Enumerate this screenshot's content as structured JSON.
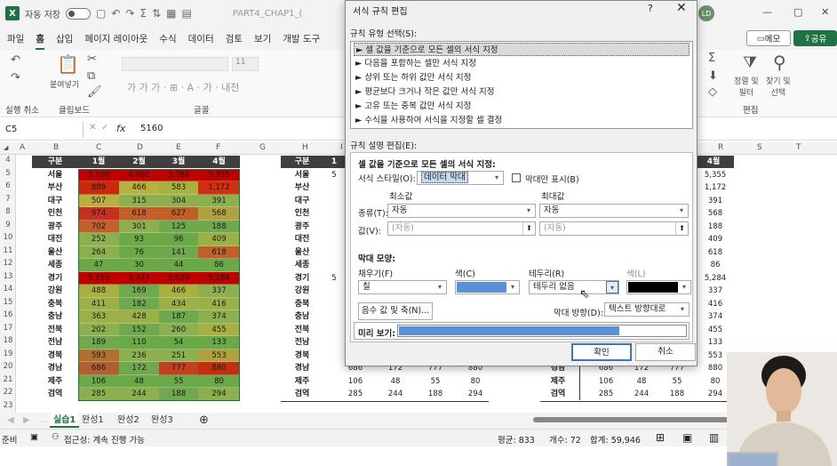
{
  "titlebar": {
    "app_icon": "X",
    "autosave": "자동 저장",
    "filename": "PART4_CHAP1_(",
    "avatar": "LD",
    "icons": [
      "save-icon",
      "undo-icon",
      "redo-icon"
    ]
  },
  "tabs": [
    "파일",
    "홈",
    "삽입",
    "페이지 레이아웃",
    "수식",
    "데이터",
    "검토",
    "보기",
    "개발 도구"
  ],
  "active_tab": "홈",
  "buttons": {
    "memo": "메모",
    "share": "공유"
  },
  "ribbon": {
    "undo_label": "실행 취소",
    "clipboard_label": "클립보드",
    "paste_label": "붙여넣기",
    "font_label": "글꼴",
    "font_size": "11",
    "edit_label": "편집",
    "sort_filter": "정렬 및\n필터",
    "find_select": "찾기 및\n선택"
  },
  "formula_bar": {
    "name_box": "C5",
    "fx": "fx",
    "value": "5160"
  },
  "columns": [
    "A",
    "B",
    "C",
    "D",
    "E",
    "F",
    "G",
    "H",
    "I",
    "R",
    "S",
    "T"
  ],
  "rows": [
    "4",
    "5",
    "6",
    "7",
    "8",
    "9",
    "10",
    "11",
    "12",
    "13",
    "14",
    "15",
    "16",
    "17",
    "18",
    "19",
    "20",
    "21",
    "22",
    "23"
  ],
  "table_left": {
    "headers": [
      "구분",
      "1월",
      "2월",
      "3월",
      "4월"
    ],
    "rows": [
      {
        "region": "서울",
        "v": [
          "5,160",
          "4,080",
          "3,784",
          "5,355"
        ]
      },
      {
        "region": "부산",
        "v": [
          "889",
          "466",
          "583",
          "1,172"
        ]
      },
      {
        "region": "대구",
        "v": [
          "507",
          "315",
          "304",
          "391"
        ]
      },
      {
        "region": "인천",
        "v": [
          "974",
          "618",
          "627",
          "568"
        ]
      },
      {
        "region": "광주",
        "v": [
          "702",
          "301",
          "125",
          "188"
        ]
      },
      {
        "region": "대전",
        "v": [
          "252",
          "93",
          "96",
          "409"
        ]
      },
      {
        "region": "울산",
        "v": [
          "264",
          "76",
          "141",
          "618"
        ]
      },
      {
        "region": "세종",
        "v": [
          "47",
          "30",
          "44",
          "86"
        ]
      },
      {
        "region": "경기",
        "v": [
          "5,153",
          "3,747",
          "5,029",
          "5,284"
        ]
      },
      {
        "region": "강원",
        "v": [
          "488",
          "169",
          "466",
          "337"
        ]
      },
      {
        "region": "충북",
        "v": [
          "411",
          "182",
          "434",
          "416"
        ]
      },
      {
        "region": "충남",
        "v": [
          "363",
          "428",
          "187",
          "374"
        ]
      },
      {
        "region": "전북",
        "v": [
          "202",
          "152",
          "260",
          "455"
        ]
      },
      {
        "region": "전남",
        "v": [
          "189",
          "110",
          "54",
          "133"
        ]
      },
      {
        "region": "경북",
        "v": [
          "593",
          "236",
          "251",
          "553"
        ]
      },
      {
        "region": "경남",
        "v": [
          "686",
          "172",
          "777",
          "880"
        ]
      },
      {
        "region": "제주",
        "v": [
          "106",
          "48",
          "55",
          "80"
        ]
      },
      {
        "region": "검역",
        "v": [
          "285",
          "244",
          "188",
          "294"
        ]
      }
    ],
    "colors": [
      [
        "#c00000",
        "#c00000",
        "#c00000",
        "#c00000"
      ],
      [
        "#c82a0a",
        "#b8b040",
        "#a8b040",
        "#d03010"
      ],
      [
        "#b8b040",
        "#8cb050",
        "#8cb050",
        "#8cb050"
      ],
      [
        "#c63020",
        "#c06028",
        "#c06028",
        "#b0a040"
      ],
      [
        "#c0602a",
        "#8cb050",
        "#70a850",
        "#70a850"
      ],
      [
        "#8cb050",
        "#6aa848",
        "#6aa848",
        "#9cb048"
      ],
      [
        "#8cb050",
        "#6aa848",
        "#70a850",
        "#c06028"
      ],
      [
        "#6aa848",
        "#6aa848",
        "#6aa848",
        "#6aa848"
      ],
      [
        "#c00000",
        "#c00000",
        "#c00000",
        "#c00000"
      ],
      [
        "#a8b040",
        "#70a850",
        "#a8b040",
        "#8cb050"
      ],
      [
        "#9cb048",
        "#70a850",
        "#9cb048",
        "#9cb048"
      ],
      [
        "#9cb048",
        "#9cb048",
        "#70a850",
        "#8cb050"
      ],
      [
        "#8cb050",
        "#70a850",
        "#8cb050",
        "#a8b040"
      ],
      [
        "#70a850",
        "#6aa848",
        "#6aa848",
        "#6aa848"
      ],
      [
        "#b07030",
        "#8cb050",
        "#8cb050",
        "#b0a040"
      ],
      [
        "#b06030",
        "#70a850",
        "#c04020",
        "#c03010"
      ],
      [
        "#6aa848",
        "#6aa848",
        "#6aa848",
        "#6aa848"
      ],
      [
        "#8cb050",
        "#8cb050",
        "#70a850",
        "#8cb050"
      ]
    ]
  },
  "table_right": {
    "h_header": "구분",
    "h_header_1": "1",
    "h_col4_header": "4월",
    "h_col4": [
      "5,355",
      "1,172",
      "391",
      "568",
      "188",
      "409",
      "618",
      "86",
      "5,284",
      "337",
      "416",
      "374",
      "455",
      "133",
      "553",
      "880",
      "80",
      "294"
    ],
    "h_regions": [
      "서울",
      "부산",
      "대구",
      "인천",
      "광주",
      "대전",
      "울산",
      "세종",
      "경기",
      "강원",
      "충북",
      "충남",
      "전북",
      "전남",
      "경북",
      "경남",
      "제주",
      "검역"
    ],
    "h_first": [
      "5",
      "",
      "",
      "",
      "",
      "",
      "",
      "",
      "5",
      "",
      "",
      "",
      "",
      "",
      "",
      "",
      "",
      ""
    ],
    "bottom_rows": [
      {
        "region": "경남",
        "v": [
          "686",
          "172",
          "777",
          "880"
        ]
      },
      {
        "region": "제주",
        "v": [
          "106",
          "48",
          "55",
          "80"
        ]
      },
      {
        "region": "검역",
        "v": [
          "285",
          "244",
          "188",
          "294"
        ]
      }
    ]
  },
  "dialog": {
    "title": "서식 규칙 편집",
    "help": "?",
    "close": "✕",
    "rule_type_label": "규칙 유형 선택(S):",
    "rule_types": [
      "► 셀 값을 기준으로 모든 셀의 서식 지정",
      "► 다음을 포함하는 셀만 서식 지정",
      "► 상위 또는 하위 값만 서식 지정",
      "► 평균보다 크거나 작은 값만 서식 지정",
      "► 고유 또는 중복 값만 서식 지정",
      "► 수식을 사용하여 서식을 지정할 셀 결정"
    ],
    "desc_label": "규칙 설명 편집(E):",
    "desc_title": "셀 값을 기준으로 모든 셀의 서식 지정:",
    "format_style_label": "서식 스타일(O):",
    "format_style_value": "데이터 막대",
    "bar_only_label": "막대만 표시(B)",
    "min_label": "최소값",
    "max_label": "최대값",
    "type_label": "종류(T):",
    "type_min": "자동",
    "type_max": "자동",
    "value_label": "값(V):",
    "value_min": "(자동)",
    "value_max": "(자동)",
    "bar_section": "막대 모양:",
    "fill_label": "채우기(F)",
    "fill_value": "칠",
    "color_label": "색(C)",
    "border_label": "테두리(R)",
    "border_value": "테두리 없음",
    "border_color_label": "색(L)",
    "neg_button": "음수 값 및 축(N)...",
    "direction_label": "막대 방향(D):",
    "direction_value": "텍스트 방향대로",
    "preview_label": "미리 보기:",
    "ok": "확인",
    "cancel": "취소",
    "bar_color": "#5b8fd6",
    "border_color": "#000000"
  },
  "sheet_tabs": [
    "실습1",
    "완성1",
    "완성2",
    "완성3"
  ],
  "active_sheet": "실습1",
  "statusbar": {
    "ready": "준비",
    "accessibility": "접근성: 계속 진행 가능",
    "avg": "평균: 833",
    "count": "개수: 72",
    "sum": "합계: 59,946"
  }
}
